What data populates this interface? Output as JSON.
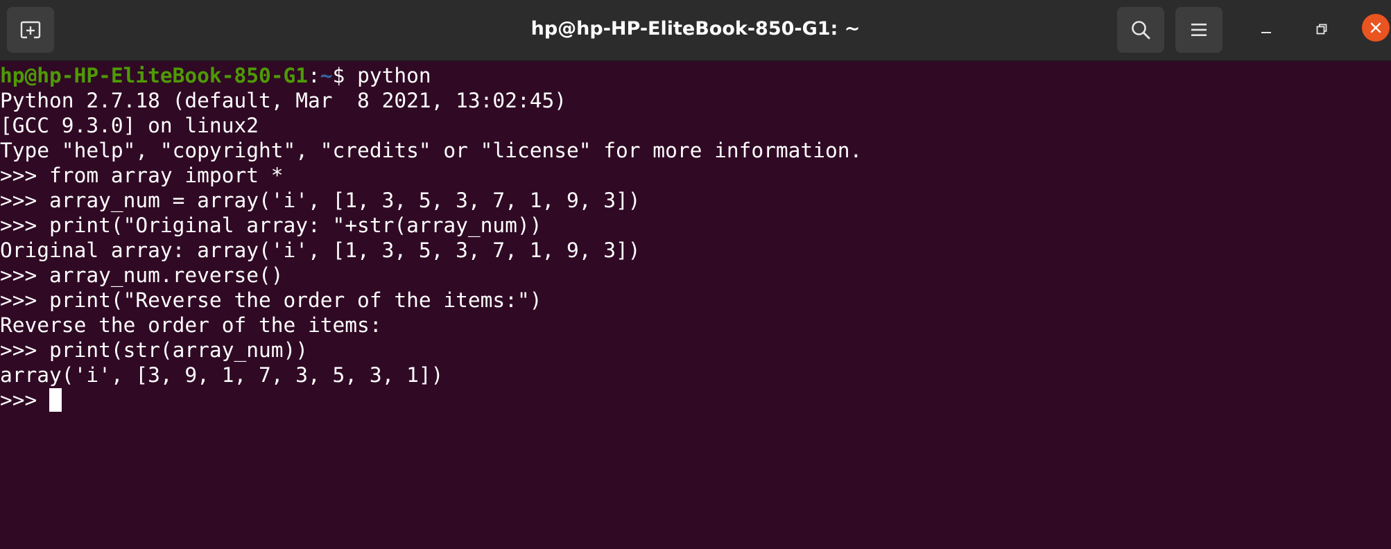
{
  "window": {
    "title": "hp@hp-HP-EliteBook-850-G1: ~",
    "icons": {
      "new_tab": "new-tab-icon",
      "search": "search-icon",
      "menu": "hamburger-menu-icon",
      "minimize": "minimize-icon",
      "restore": "restore-icon",
      "close": "close-icon"
    },
    "colors": {
      "titlebar": "#2c2c2c",
      "terminal_bg": "#300a24",
      "prompt_user": "#4e9a06",
      "prompt_dir": "#3465a4",
      "close_button": "#e95420"
    }
  },
  "terminal": {
    "prompt": {
      "user_host": "hp@hp-HP-EliteBook-850-G1",
      "colon": ":",
      "dir": "~",
      "dollar": "$ ",
      "command": "python"
    },
    "lines": [
      "Python 2.7.18 (default, Mar  8 2021, 13:02:45)",
      "[GCC 9.3.0] on linux2",
      "Type \"help\", \"copyright\", \"credits\" or \"license\" for more information.",
      ">>> from array import *",
      ">>> array_num = array('i', [1, 3, 5, 3, 7, 1, 9, 3])",
      ">>> print(\"Original array: \"+str(array_num))",
      "Original array: array('i', [1, 3, 5, 3, 7, 1, 9, 3])",
      ">>> array_num.reverse()",
      ">>> print(\"Reverse the order of the items:\")",
      "Reverse the order of the items:",
      ">>> print(str(array_num))",
      "array('i', [3, 9, 1, 7, 3, 5, 3, 1])"
    ],
    "current_prompt": ">>> "
  }
}
